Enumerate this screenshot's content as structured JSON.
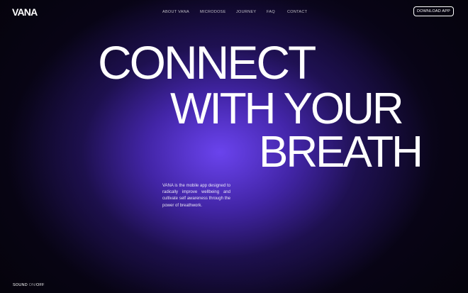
{
  "brand": {
    "logo": "VANA"
  },
  "nav": {
    "items": [
      {
        "label": "ABOUT VANA"
      },
      {
        "label": "MICRODOSE"
      },
      {
        "label": "JOURNEY"
      },
      {
        "label": "FAQ"
      },
      {
        "label": "CONTACT"
      }
    ],
    "cta_label": "DOWNLOAD APP"
  },
  "hero": {
    "line1": "CONNECT",
    "line2": "WITH YOUR",
    "line3": "BREATH",
    "description": "VANA is the mobile app designed to radically improve wellbeing and cultivate self awareness through the power of breathwork."
  },
  "sound_toggle": {
    "label": "SOUND",
    "on": "ON",
    "separator": "/",
    "off": "OFF"
  },
  "colors": {
    "background": "#05030c",
    "glow": "#6e46f5",
    "text": "#ffffff"
  }
}
